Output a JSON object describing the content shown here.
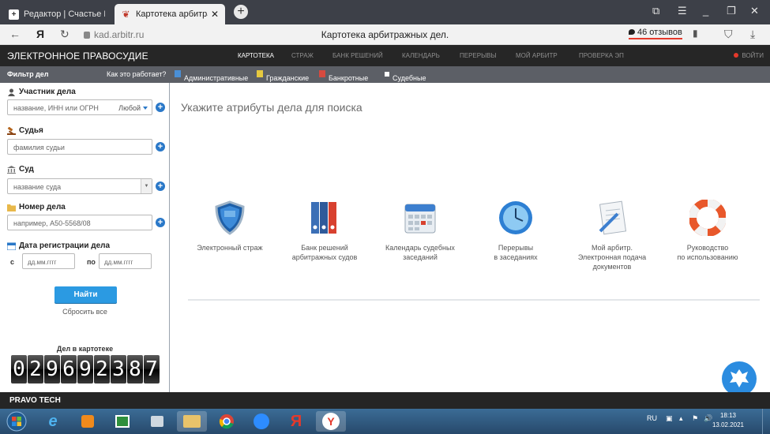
{
  "browser": {
    "tabs": [
      {
        "title": "Редактор | Счастье Есть! |",
        "active": false
      },
      {
        "title": "Картотека арбитражны",
        "active": true
      }
    ],
    "tab_close": "✕",
    "new_tab": "+",
    "url": "kad.arbitr.ru",
    "page_title": "Картотека арбитражных дел.",
    "reviews": "46 отзывов"
  },
  "site": {
    "brand": "ЭЛЕКТРОННОЕ ПРАВОСУДИЕ",
    "nav": [
      {
        "label": "КАРТОТЕКА",
        "active": true
      },
      {
        "label": "СТРАЖ"
      },
      {
        "label": "БАНК РЕШЕНИЙ"
      },
      {
        "label": "КАЛЕНДАРЬ"
      },
      {
        "label": "ПЕРЕРЫВЫ"
      },
      {
        "label": "МОЙ АРБИТР"
      },
      {
        "label": "ПРОВЕРКА ЭП"
      }
    ],
    "login": "ВОЙТИ"
  },
  "filterbar": {
    "title": "Фильтр дел",
    "how": "Как это работает?",
    "types": [
      "Административные",
      "Гражданские",
      "Банкротные",
      "Судебные поручения"
    ]
  },
  "filters": {
    "participant_label": "Участник дела",
    "participant_placeholder": "название, ИНН или ОГРН",
    "participant_any": "Любой",
    "judge_label": "Судья",
    "judge_placeholder": "фамилия судьи",
    "court_label": "Суд",
    "court_placeholder": "название суда",
    "case_label": "Номер дела",
    "case_placeholder": "например, А50-5568/08",
    "date_label": "Дата регистрации дела",
    "date_from": "с",
    "date_to": "по",
    "date_placeholder": "дд.мм.гггг",
    "find": "Найти",
    "reset": "Сбросить все",
    "counter_title": "Дел в картотеке",
    "counter_digits": [
      "0",
      "2",
      "9",
      "6",
      "9",
      "2",
      "3",
      "8",
      "7"
    ]
  },
  "main": {
    "prompt": "Укажите атрибуты дела для поиска",
    "services": [
      {
        "label": "Электронный страж"
      },
      {
        "label": "Банк решений\nарбитражных судов"
      },
      {
        "label": "Календарь судебных\nзаседаний"
      },
      {
        "label": "Перерывы\nв заседаниях"
      },
      {
        "label": "Мой арбитр.\nЭлектронная подача\nдокументов"
      },
      {
        "label": "Руководство\nпо использованию"
      }
    ]
  },
  "statusbar": {
    "brand": "PRAVO TECH"
  },
  "taskbar": {
    "lang": "RU",
    "time": "18:13",
    "date": "13.02.2021"
  },
  "colors": {
    "header_bg": "#262626",
    "filterbar_bg": "#5c5f66",
    "accent_blue": "#2b9ae2",
    "login_dot": "#e5392b"
  }
}
